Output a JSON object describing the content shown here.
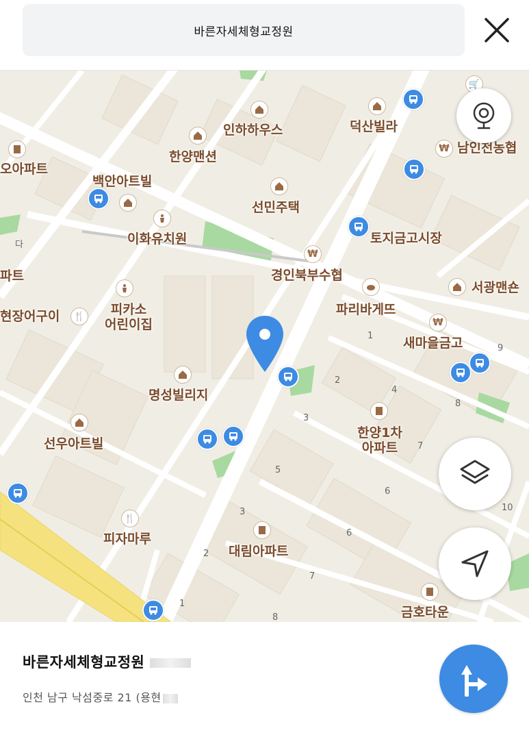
{
  "header": {
    "title": "바른자세체형교정원",
    "close_icon": "close-icon"
  },
  "map": {
    "labels": {
      "inha_house": "인하하우스",
      "deoksan": "덕산빌라",
      "hanyang_mansion": "한양맨션",
      "namin": "남인천농협",
      "oh_apt": "오아파트",
      "baekan": "백안아트빌",
      "seonmin": "선민주택",
      "toji": "토지금고시장",
      "ihwa": "이화유치원",
      "gyeongin": "경인북부수협",
      "pateu": "파트",
      "seogwang": "서광맨숀",
      "picasso1": "피카소",
      "picasso2": "어린이집",
      "paris": "파리바게뜨",
      "hyeonjang": "현장어구이",
      "saemaeul": "새마을금고",
      "myeongseong": "명성빌리지",
      "hanyang1a": "한양1차",
      "hanyang1b": "아파트",
      "seonu": "선우아트빌",
      "pizza": "피자마루",
      "daerim": "대림아파트",
      "geumho": "금호타운",
      "da": "다"
    },
    "block_numbers": [
      "1",
      "2",
      "3",
      "4",
      "5",
      "6",
      "7",
      "8",
      "9",
      "10",
      "3",
      "6",
      "2",
      "7",
      "1",
      "8"
    ],
    "accent_color": "#3d8be3",
    "road_color": "#f5e27f"
  },
  "controls": {
    "cctv_icon": "cctv-icon",
    "layers_icon": "layers-icon",
    "locate_icon": "navigation-arrow-icon"
  },
  "sheet": {
    "name": "바른자세체형교정원",
    "address": "인천 남구 낙섬중로 21 (용현",
    "route_icon": "directions-icon"
  }
}
